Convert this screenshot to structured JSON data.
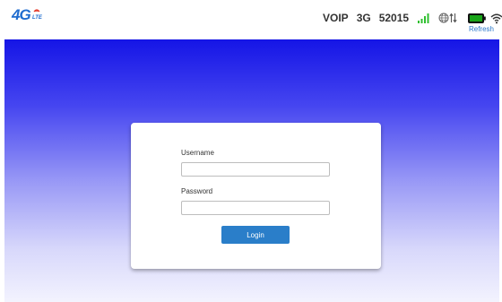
{
  "header": {
    "logo": {
      "main": "4G",
      "sub": "LTE"
    },
    "status": {
      "voip": "VOIP",
      "network_type": "3G",
      "network_code": "52015"
    },
    "refresh_label": "Refresh"
  },
  "login": {
    "username_label": "Username",
    "username_value": "",
    "password_label": "Password",
    "password_value": "",
    "button_label": "Login"
  },
  "colors": {
    "brand": "#1f6ccf",
    "login_button": "#2a7ec9",
    "signal": "#2fbf2f",
    "battery": "#19a519",
    "hero_top": "#1515e6",
    "hero_bottom": "#f3f3fe"
  }
}
